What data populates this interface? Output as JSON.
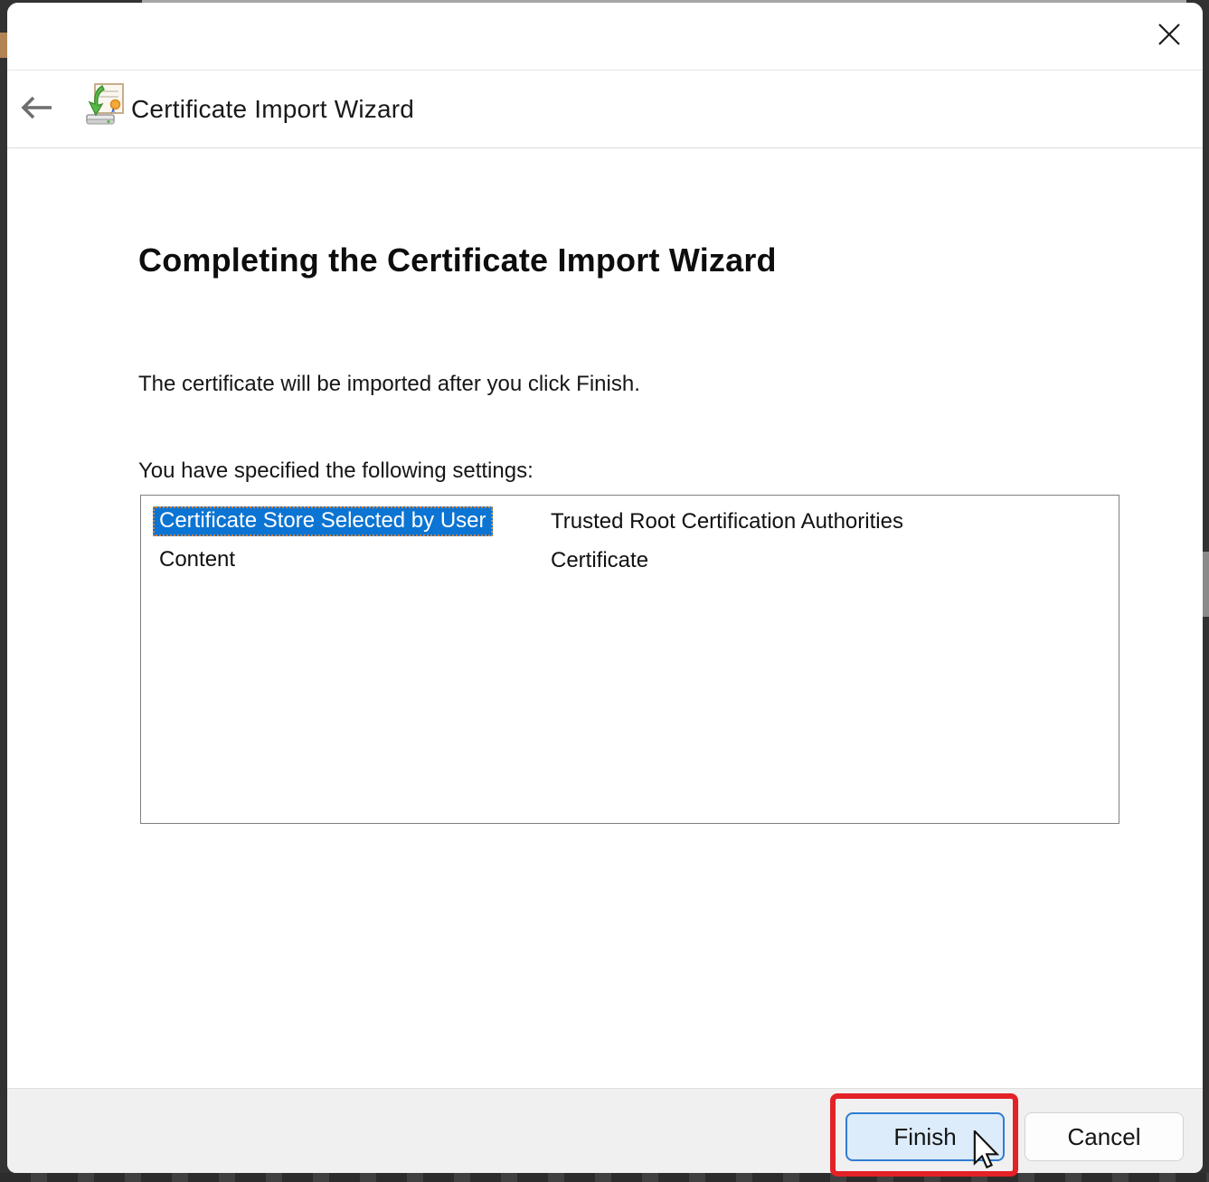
{
  "header": {
    "title": "Certificate Import Wizard"
  },
  "content": {
    "heading": "Completing the Certificate Import Wizard",
    "intro": "The certificate will be imported after you click Finish.",
    "settings_label": "You have specified the following settings:",
    "settings": [
      {
        "name": "Certificate Store Selected by User",
        "value": "Trusted Root Certification Authorities",
        "selected": true
      },
      {
        "name": "Content",
        "value": "Certificate",
        "selected": false
      }
    ]
  },
  "footer": {
    "finish_label": "Finish",
    "cancel_label": "Cancel"
  },
  "annotation": {
    "shape": "red-highlight-box",
    "target": "finish-button"
  },
  "cursor": {
    "type": "arrow"
  },
  "icons": {
    "close": "close-icon",
    "back": "back-arrow-icon",
    "wizard": "certificate-import-icon"
  },
  "colors": {
    "selection_bg": "#0c74d2",
    "selection_text": "#ffffff",
    "focus_dots": "#d0843c",
    "finish_fill": "#ddecfa",
    "finish_border": "#2e7cd3",
    "footer_bg": "#f0f0f0",
    "annotation": "#e32227"
  }
}
